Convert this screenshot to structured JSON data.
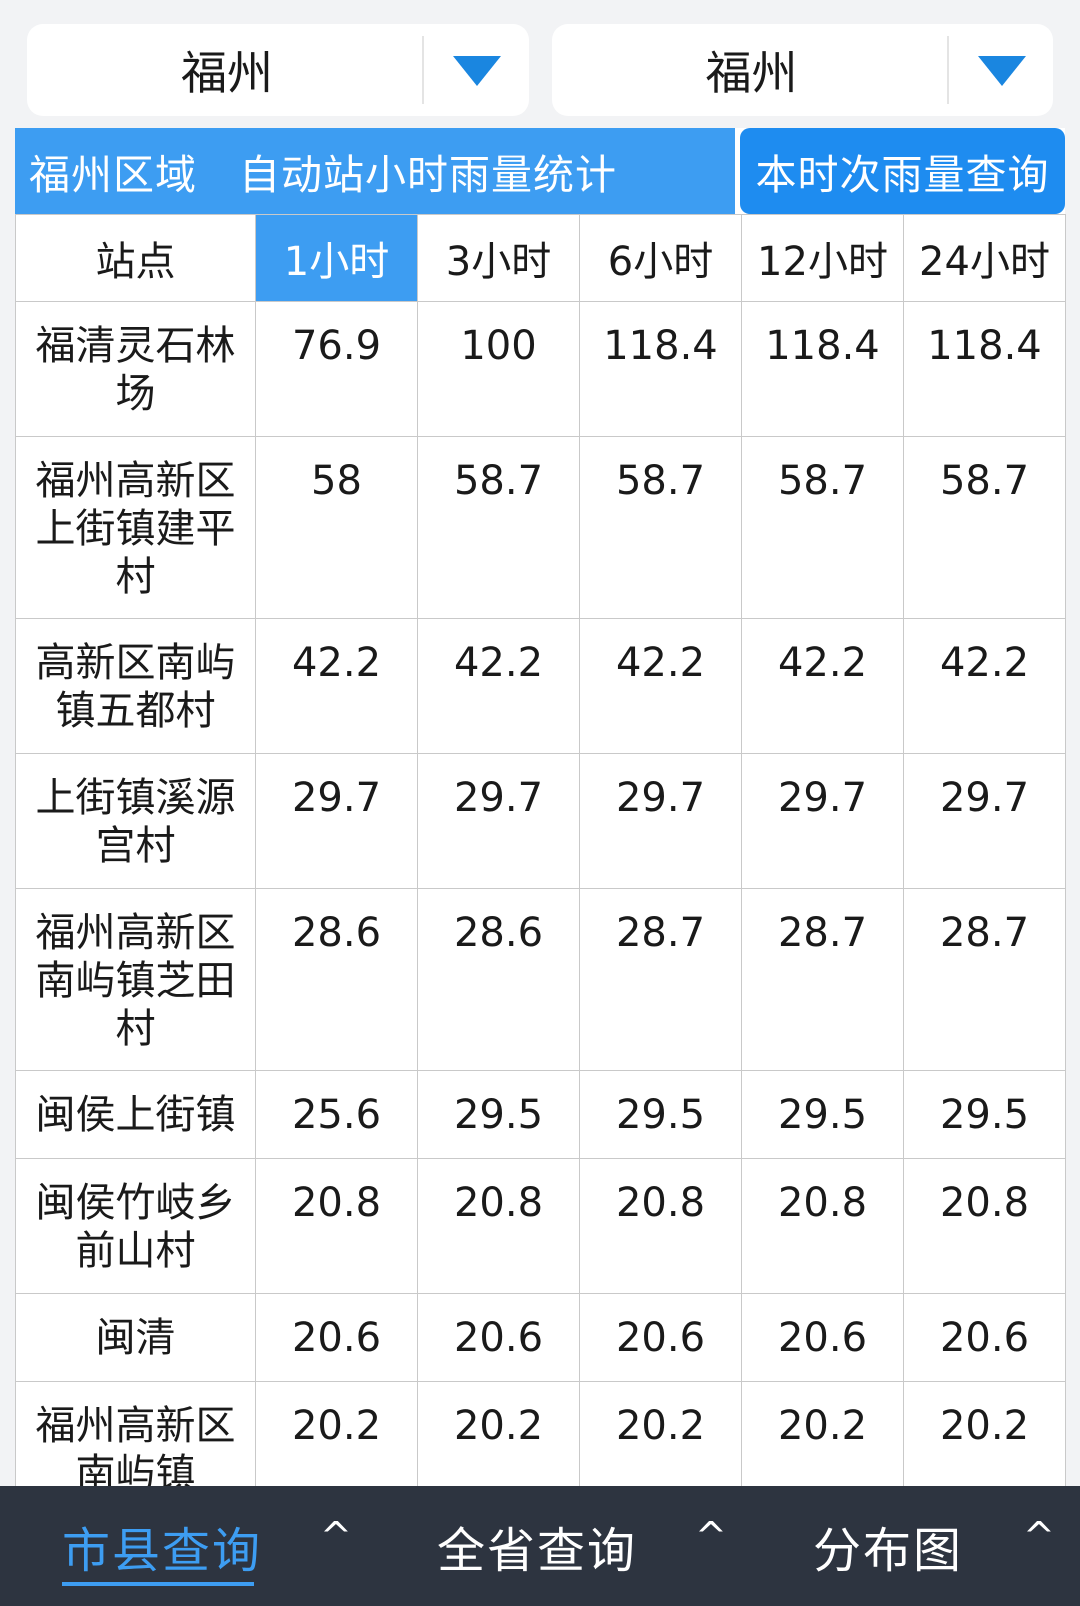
{
  "selectors": {
    "left": "福州",
    "right": "福州"
  },
  "header": {
    "title": "福州区域　自动站小时雨量统计",
    "query_button": "本时次雨量查询"
  },
  "table": {
    "columns": [
      "站点",
      "1小时",
      "3小时",
      "6小时",
      "12小时",
      "24小时"
    ],
    "active_column": "1小时",
    "rows": [
      {
        "station": "福清灵石林场",
        "values": [
          "76.9",
          "100",
          "118.4",
          "118.4",
          "118.4"
        ]
      },
      {
        "station": "福州高新区上街镇建平村",
        "values": [
          "58",
          "58.7",
          "58.7",
          "58.7",
          "58.7"
        ]
      },
      {
        "station": "高新区南屿镇五都村",
        "values": [
          "42.2",
          "42.2",
          "42.2",
          "42.2",
          "42.2"
        ]
      },
      {
        "station": "上街镇溪源宫村",
        "values": [
          "29.7",
          "29.7",
          "29.7",
          "29.7",
          "29.7"
        ]
      },
      {
        "station": "福州高新区南屿镇芝田村",
        "values": [
          "28.6",
          "28.6",
          "28.7",
          "28.7",
          "28.7"
        ]
      },
      {
        "station": "闽侯上街镇",
        "values": [
          "25.6",
          "29.5",
          "29.5",
          "29.5",
          "29.5"
        ]
      },
      {
        "station": "闽侯竹岐乡前山村",
        "values": [
          "20.8",
          "20.8",
          "20.8",
          "20.8",
          "20.8"
        ]
      },
      {
        "station": "闽清",
        "values": [
          "20.6",
          "20.6",
          "20.6",
          "20.6",
          "20.6"
        ]
      },
      {
        "station": "福州高新区南屿镇",
        "values": [
          "20.2",
          "20.2",
          "20.2",
          "20.2",
          "20.2"
        ]
      }
    ]
  },
  "bottom_nav": {
    "items": [
      {
        "label": "市县查询",
        "active": true
      },
      {
        "label": "全省查询",
        "active": false
      },
      {
        "label": "分布图",
        "active": false
      }
    ],
    "chevron": "^"
  },
  "colors": {
    "accent": "#3d9df2",
    "button": "#1e8cf0",
    "nav_background": "#2d3440"
  }
}
